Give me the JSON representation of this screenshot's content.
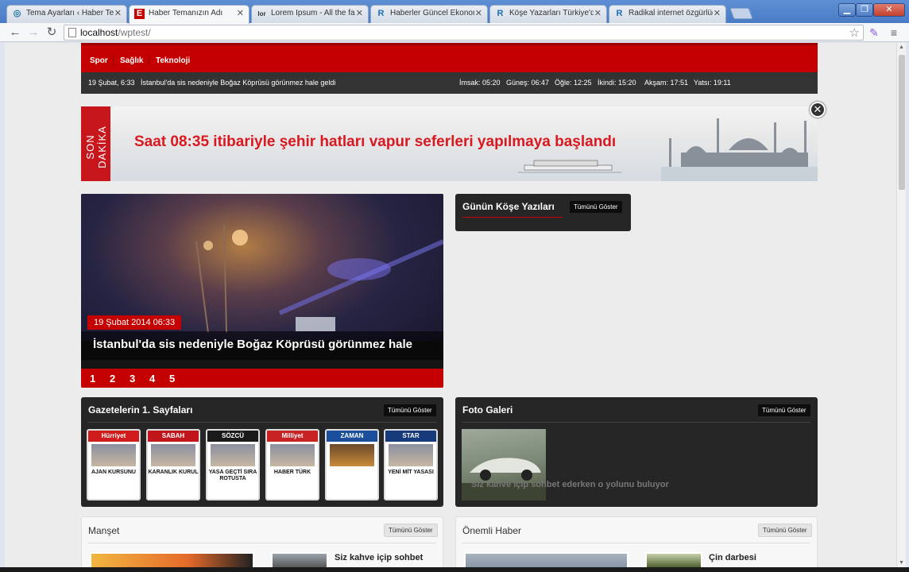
{
  "browser": {
    "tabs": [
      {
        "label": "Tema Ayarları ‹ Haber Tem",
        "icon": "wordpress-icon"
      },
      {
        "label": "Haber Temanızın Adı",
        "icon": "e-logo-icon"
      },
      {
        "label": "Lorem Ipsum - All the fact",
        "icon": "lorem-ipsum-icon"
      },
      {
        "label": "Haberler Güncel Ekonomi",
        "icon": "r-logo-icon"
      },
      {
        "label": "Köşe Yazarları Türkiye'de",
        "icon": "r-logo-icon"
      },
      {
        "label": "Radikal internet özgürlüğü",
        "icon": "r-logo-icon"
      }
    ],
    "url_host": "localhost",
    "url_path": "/wptest/",
    "colors": {
      "tabbar": "#4a7cc6",
      "accent": "#c40000"
    }
  },
  "site": {
    "menu": [
      "Spor",
      "Sağlık",
      "Teknoloji"
    ],
    "ticker": {
      "date": "19 Şubat, 6:33",
      "text": "İstanbul'da sis nedeniyle Boğaz Köprüsü görünmez hale geldi"
    },
    "prayer_times": [
      "İmsak: 05:20",
      "Güneş: 06:47",
      "Öğle: 12:25",
      "İkindi: 15:20",
      "Akşam: 17:51",
      "Yatsı: 19:11"
    ],
    "banner": {
      "tag": "SON DAKİKA",
      "text": "Saat 08:35 itibariyle şehir hatları vapur seferleri yapılmaya başlandı"
    },
    "slider": {
      "date": "19 Şubat 2014 06:33",
      "headline": "İstanbul'da sis nedeniyle Boğaz Köprüsü görünmez hale",
      "pages": [
        "1",
        "2",
        "3",
        "4",
        "5"
      ]
    },
    "columnists": {
      "title": "Günün Köşe Yazıları",
      "button": "Tümünü Göster"
    },
    "newspapers": {
      "title": "Gazetelerin 1. Sayfaları",
      "button": "Tümünü Göster",
      "items": [
        {
          "masthead": "Hürriyet",
          "headline": "AJAN KURSUNU",
          "color": "#d01c1c"
        },
        {
          "masthead": "SABAH",
          "headline": "KARANLIK KURUL",
          "color": "#c0151b"
        },
        {
          "masthead": "SÖZCÜ",
          "headline": "YASA GEÇTİ SIRA ROTUSTA",
          "color": "#1a1a1a"
        },
        {
          "masthead": "Milliyet",
          "headline": "HABER TÜRK",
          "color": "#c82323"
        },
        {
          "masthead": "ZAMAN",
          "headline": "",
          "color": "#1b4f9c"
        },
        {
          "masthead": "STAR",
          "headline": "YENİ MİT YASASI",
          "color": "#163a7a"
        }
      ]
    },
    "gallery": {
      "title": "Foto Galeri",
      "button": "Tümünü Göster",
      "caption": "Siz kahve içip sohbet ederken o yolunu buluyor"
    },
    "manset": {
      "title": "Manşet",
      "button": "Tümünü Göster",
      "item": "Siz kahve içip sohbet"
    },
    "important": {
      "title": "Önemli Haber",
      "button": "Tümünü Göster",
      "item": "Çin darbesi"
    }
  }
}
